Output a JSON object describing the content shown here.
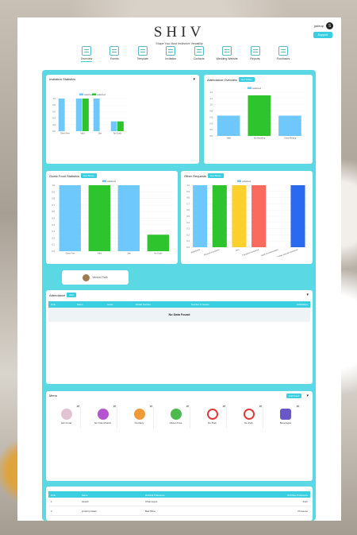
{
  "header": {
    "logo": "SHIV",
    "tagline": "Shape Your Most Instinctive Versatility",
    "user_name": "jadeup",
    "avatar_letter": "S",
    "support_label": "Support"
  },
  "nav": [
    {
      "label": "Overview",
      "icon": "overview-icon",
      "active": true
    },
    {
      "label": "Events",
      "icon": "events-icon"
    },
    {
      "label": "Template",
      "icon": "template-icon"
    },
    {
      "label": "Invitation",
      "icon": "invitation-icon"
    },
    {
      "label": "Contacts",
      "icon": "contacts-icon"
    },
    {
      "label": "Wedding Website",
      "icon": "website-icon"
    },
    {
      "label": "Reports",
      "icon": "reports-icon"
    },
    {
      "label": "Purchases",
      "icon": "purchases-icon"
    }
  ],
  "colors": {
    "accent": "#39cfe0",
    "panel": "#5ad8e4",
    "blue": "#6fc8fb",
    "green": "#2dc42d",
    "yellow": "#fdd02b",
    "red": "#fa6a5e",
    "darkblue": "#2a6af0"
  },
  "invitation_statistics": {
    "title": "Invitation Statistics",
    "legend": [
      "undefined",
      "undefined"
    ]
  },
  "attendance_overview": {
    "title": "Attendance Overview",
    "pill": "Get Share",
    "legend": "undefined"
  },
  "guest_food": {
    "title": "Guest Food Statistics",
    "pill": "Get Share",
    "legend": "undefined"
  },
  "other_requests": {
    "title": "Other Requests",
    "pill": "Get Share",
    "legend": "undefined"
  },
  "chart_data": [
    {
      "type": "bar",
      "categories": [
        "Given Free",
        "Valid",
        "Jain",
        "No Guide"
      ],
      "ylim": [
        0,
        1
      ],
      "series": [
        {
          "values": [
            1,
            1,
            1,
            0.3
          ]
        },
        {
          "values": [
            0,
            1,
            0,
            0.3
          ]
        }
      ]
    },
    {
      "type": "bar",
      "categories": [
        "Valid",
        "Not Attending",
        "Guest Missing"
      ],
      "ylim": [
        0,
        1.4
      ],
      "values": [
        0.65,
        1.3,
        0.65
      ]
    },
    {
      "type": "bar",
      "categories": [
        "Given Free",
        "Valid",
        "Jain",
        "No Guide"
      ],
      "ylim": [
        0,
        1
      ],
      "values": [
        1,
        1,
        1,
        0.25
      ]
    },
    {
      "type": "bar",
      "categories": [
        "Wheelchair",
        "Physical Assistance",
        "Bus",
        "Transport Assistance",
        "Hotel Accommodation",
        "Wheelchair Special Assistance"
      ],
      "ylim": [
        0,
        1
      ],
      "values": [
        1,
        1,
        1,
        1,
        0,
        1
      ]
    }
  ],
  "vendor_card": {
    "label": "Vendor Ruth"
  },
  "attendance": {
    "title": "Attendance",
    "pill": "Add",
    "columns": [
      "S.No",
      "Name",
      "Guest",
      "Mobile Number",
      "Number of Guests",
      "Edit/Delete"
    ],
    "empty": "No Data Found"
  },
  "menu": {
    "title": "Menu",
    "button": "Add Food",
    "items": [
      {
        "label": "Jain Food",
        "count": "20",
        "icon": "jain-food-icon"
      },
      {
        "label": "No Onion/Garlic",
        "count": "20",
        "icon": "no-onion-garlic-icon"
      },
      {
        "label": "No Dairy",
        "count": "20",
        "icon": "no-dairy-icon"
      },
      {
        "label": "Gluten Free",
        "count": "20",
        "icon": "gluten-free-icon"
      },
      {
        "label": "No Pork",
        "count": "20",
        "icon": "no-pork-icon"
      },
      {
        "label": "No Pork",
        "count": "20",
        "icon": "no-pork-icon"
      },
      {
        "label": "Beverages",
        "count": "20",
        "icon": "beverages-icon"
      }
    ]
  },
  "food_table": {
    "columns": [
      "S.No",
      "Name",
      "Dir/DHS Preference",
      "Dir/Other Preference"
    ],
    "rows": [
      [
        "1",
        "lokesh",
        "Chamoupts",
        "Rum"
      ],
      [
        "2",
        "juvasri jurisam",
        "Bad Wine",
        "Prosecco"
      ]
    ]
  }
}
